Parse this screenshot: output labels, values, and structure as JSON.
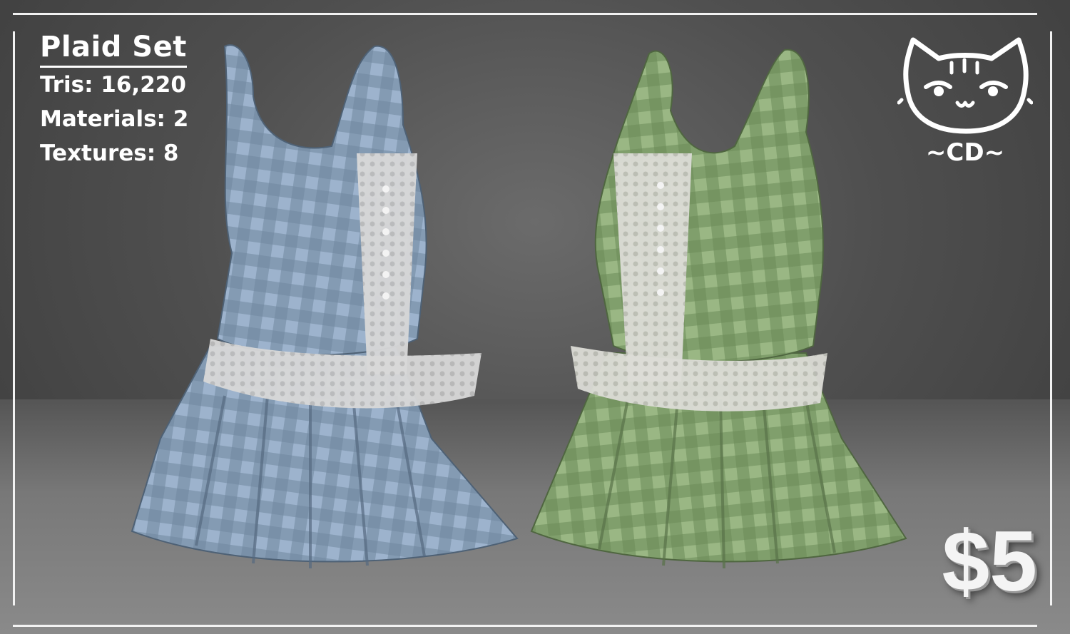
{
  "product": {
    "title": "Plaid Set",
    "stats": [
      "Tris: 16,220",
      "Materials: 2",
      "Textures: 8"
    ],
    "price": "$5"
  },
  "logo": {
    "icon": "cat-face-icon",
    "text": "~CD~"
  },
  "dresses": [
    {
      "name": "blue-plaid-dress",
      "color": "#8ea6c3",
      "check": "#5f7891"
    },
    {
      "name": "green-plaid-dress",
      "color": "#93b07c",
      "check": "#647f52"
    }
  ]
}
